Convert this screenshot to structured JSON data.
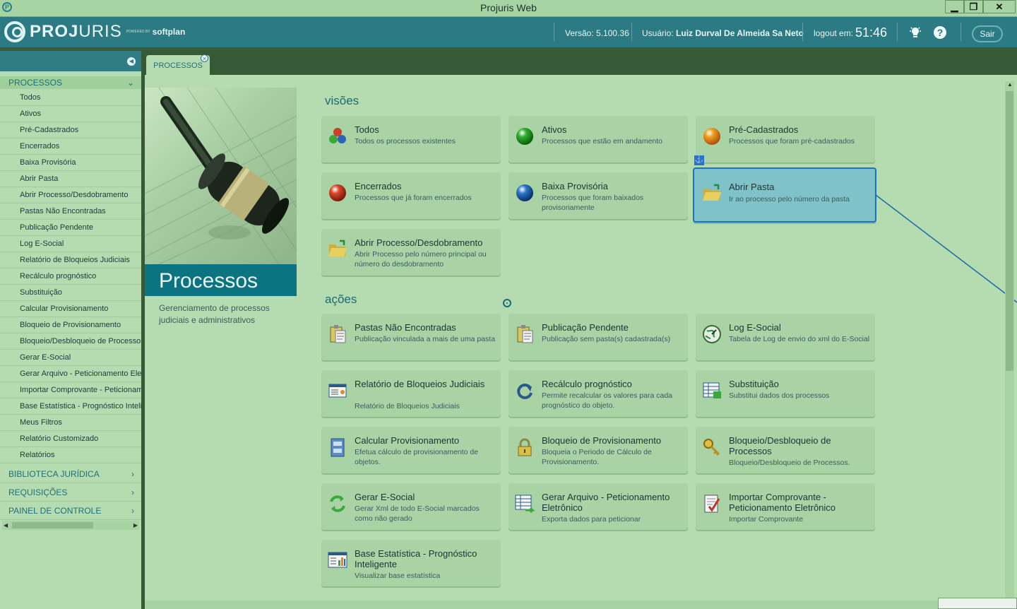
{
  "window": {
    "title": "Projuris Web",
    "app_icon": "P",
    "minimize": "▁",
    "restore": "❐",
    "close": "✕"
  },
  "header": {
    "brand_bold": "PROJ",
    "brand_rest": "URIS",
    "powered_by": "POWERED BY",
    "softplan": "softplan",
    "version_label": "Versão:",
    "version": "5.100.36",
    "user_label": "Usuário:",
    "user": "Luiz Durval De Almeida Sa Neto",
    "logout_label": "logout em:",
    "logout_time": "51:46",
    "sair": "Sair",
    "bulb_icon": "lightbulb-icon",
    "help_icon": "?"
  },
  "tab": {
    "label": "PROCESSOS",
    "close": "×"
  },
  "sidebar": {
    "collapse": "◀",
    "active_section": "PROCESSOS",
    "items": [
      "Todos",
      "Ativos",
      "Pré-Cadastrados",
      "Encerrados",
      "Baixa Provisória",
      "Abrir Pasta",
      "Abrir Processo/Desdobramento",
      "Pastas Não Encontradas",
      "Publicação Pendente",
      "Log E-Social",
      "Relatório de Bloqueios Judiciais",
      "Recálculo prognóstico",
      "Substituição",
      "Calcular Provisionamento",
      "Bloqueio de Provisionamento",
      "Bloqueio/Desbloqueio de Processos",
      "Gerar E-Social",
      "Gerar Arquivo - Peticionamento Eletrônico",
      "Importar Comprovante - Peticionamento Eletrônico",
      "Base Estatística - Prognóstico Inteligente",
      "Meus Filtros",
      "Relatório Customizado",
      "Relatórios"
    ],
    "sections": [
      "BIBLIOTECA JURÍDICA",
      "REQUISIÇÕES",
      "PAINEL DE CONTROLE"
    ]
  },
  "hero": {
    "title": "Processos",
    "description": "Gerenciamento de processos judiciais e administrativos"
  },
  "visoes": {
    "heading": "visões",
    "cards": [
      {
        "title": "Todos",
        "desc": "Todos os processos existentes",
        "icon": "multi-ball-icon"
      },
      {
        "title": "Ativos",
        "desc": "Processos que estão em andamento",
        "icon": "green-ball-icon"
      },
      {
        "title": "Pré-Cadastrados",
        "desc": "Processos que foram pré-cadastrados",
        "icon": "orange-ball-icon"
      },
      {
        "title": "Encerrados",
        "desc": "Processos que já foram encerrados",
        "icon": "red-ball-icon"
      },
      {
        "title": "Baixa Provisória",
        "desc": "Processos que foram baixados provisoriamente",
        "icon": "blue-ball-icon"
      },
      {
        "title": "Abrir Pasta",
        "desc": "Ir ao processo pelo número da pasta",
        "icon": "open-folder-icon"
      },
      {
        "title": "Abrir Processo/Desdobramento",
        "desc": "Abrir Processo pelo número principal ou número do desdobramento",
        "icon": "open-folder-icon"
      }
    ]
  },
  "acoes": {
    "heading": "ações",
    "cards": [
      {
        "title": "Pastas Não Encontradas",
        "desc": "Publicação vinculada a mais de uma pasta",
        "icon": "clipboard-icon"
      },
      {
        "title": "Publicação Pendente",
        "desc": "Publicação sem pasta(s) cadastrada(s)",
        "icon": "clipboard-icon"
      },
      {
        "title": "Log E-Social",
        "desc": "Tabela de Log de envio do xml do E-Social",
        "icon": "globe-icon"
      },
      {
        "title": "Relatório de Bloqueios Judiciais",
        "desc": "Relatório de Bloqueios Judiciais",
        "icon": "report-icon"
      },
      {
        "title": "Recálculo prognóstico",
        "desc": "Permite recalcular os valores para cada prognóstico do objeto.",
        "icon": "refresh-icon"
      },
      {
        "title": "Substituição",
        "desc": "Substitui dados dos processos",
        "icon": "table-edit-icon"
      },
      {
        "title": "Calcular Provisionamento",
        "desc": "Efetua cálculo de provisionamento de objetos.",
        "icon": "cabinet-icon"
      },
      {
        "title": "Bloqueio de Provisionamento",
        "desc": "Bloqueia o Periodo de Cálculo de Provisionamento.",
        "icon": "lock-icon"
      },
      {
        "title": "Bloqueio/Desbloqueio de Processos",
        "desc": "Bloqueio/Desbloqueio de Processos.",
        "icon": "key-icon"
      },
      {
        "title": "Gerar E-Social",
        "desc": "Gerar Xml de todo E-Social marcados como não gerado",
        "icon": "recycle-icon"
      },
      {
        "title": "Gerar Arquivo - Peticionamento Eletrônico",
        "desc": "Exporta dados para peticionar",
        "icon": "table-export-icon"
      },
      {
        "title": "Importar Comprovante - Peticionamento Eletrônico",
        "desc": "Importar Comprovante",
        "icon": "document-check-icon"
      },
      {
        "title": "Base Estatística - Prognóstico Inteligente",
        "desc": "Visualizar base estatística",
        "icon": "chart-doc-icon"
      }
    ]
  },
  "colors": {
    "header": "#2c7a83",
    "accent": "#1c6a72",
    "selection": "#1a72c8"
  }
}
